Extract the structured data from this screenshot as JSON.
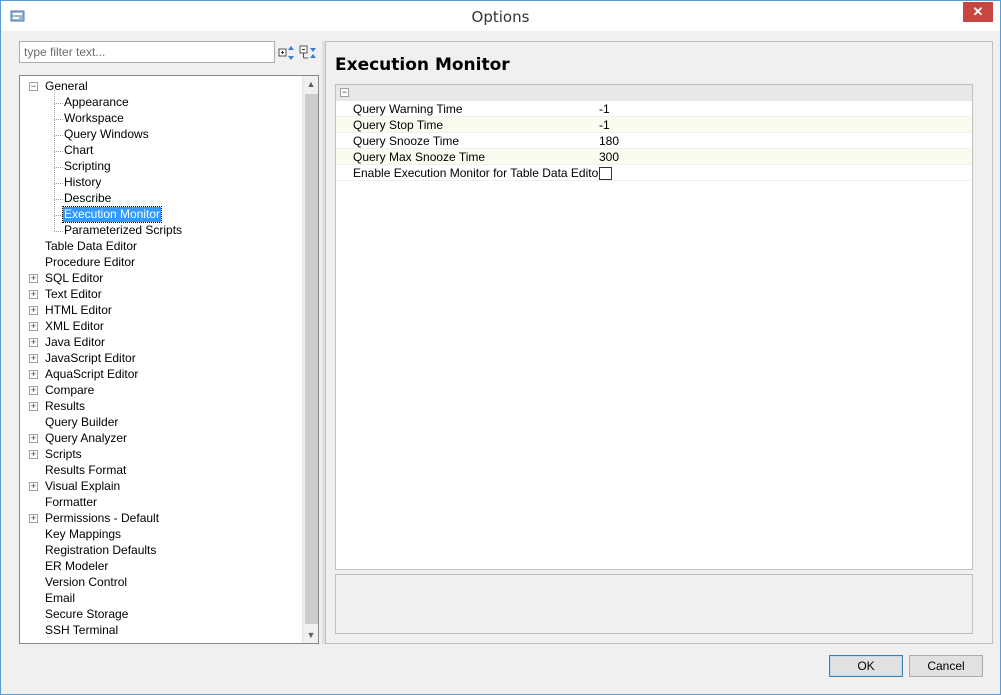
{
  "window": {
    "title": "Options",
    "close_label": "✕"
  },
  "filter": {
    "placeholder": "type filter text..."
  },
  "tree": {
    "general": {
      "label": "General",
      "children": [
        "Appearance",
        "Workspace",
        "Query Windows",
        "Chart",
        "Scripting",
        "History",
        "Describe",
        "Execution Monitor",
        "Parameterized Scripts"
      ],
      "selected": "Execution Monitor"
    },
    "items": [
      {
        "label": "Table Data Editor",
        "expandable": false
      },
      {
        "label": "Procedure Editor",
        "expandable": false
      },
      {
        "label": "SQL Editor",
        "expandable": true
      },
      {
        "label": "Text Editor",
        "expandable": true
      },
      {
        "label": "HTML Editor",
        "expandable": true
      },
      {
        "label": "XML Editor",
        "expandable": true
      },
      {
        "label": "Java Editor",
        "expandable": true
      },
      {
        "label": "JavaScript Editor",
        "expandable": true
      },
      {
        "label": "AquaScript Editor",
        "expandable": true
      },
      {
        "label": "Compare",
        "expandable": true
      },
      {
        "label": "Results",
        "expandable": true
      },
      {
        "label": "Query Builder",
        "expandable": false
      },
      {
        "label": "Query Analyzer",
        "expandable": true
      },
      {
        "label": "Scripts",
        "expandable": true
      },
      {
        "label": "Results Format",
        "expandable": false
      },
      {
        "label": "Visual Explain",
        "expandable": true
      },
      {
        "label": "Formatter",
        "expandable": false
      },
      {
        "label": "Permissions - Default",
        "expandable": true
      },
      {
        "label": "Key Mappings",
        "expandable": false
      },
      {
        "label": "Registration Defaults",
        "expandable": false
      },
      {
        "label": "ER Modeler",
        "expandable": false
      },
      {
        "label": "Version Control",
        "expandable": false
      },
      {
        "label": "Email",
        "expandable": false
      },
      {
        "label": "Secure Storage",
        "expandable": false
      },
      {
        "label": "SSH Terminal",
        "expandable": false
      }
    ]
  },
  "panel": {
    "title": "Execution Monitor",
    "properties": [
      {
        "name": "Query Warning Time",
        "value": "-1"
      },
      {
        "name": "Query Stop Time",
        "value": "-1"
      },
      {
        "name": "Query Snooze Time",
        "value": "180"
      },
      {
        "name": "Query Max Snooze Time",
        "value": "300"
      }
    ],
    "checkbox_property": {
      "name": "Enable Execution Monitor for Table Data Editor",
      "checked": false
    }
  },
  "buttons": {
    "ok": "OK",
    "cancel": "Cancel"
  },
  "colors": {
    "selection": "#3399ff",
    "close_button": "#c7463f",
    "alt_row": "#fbfbf0"
  }
}
